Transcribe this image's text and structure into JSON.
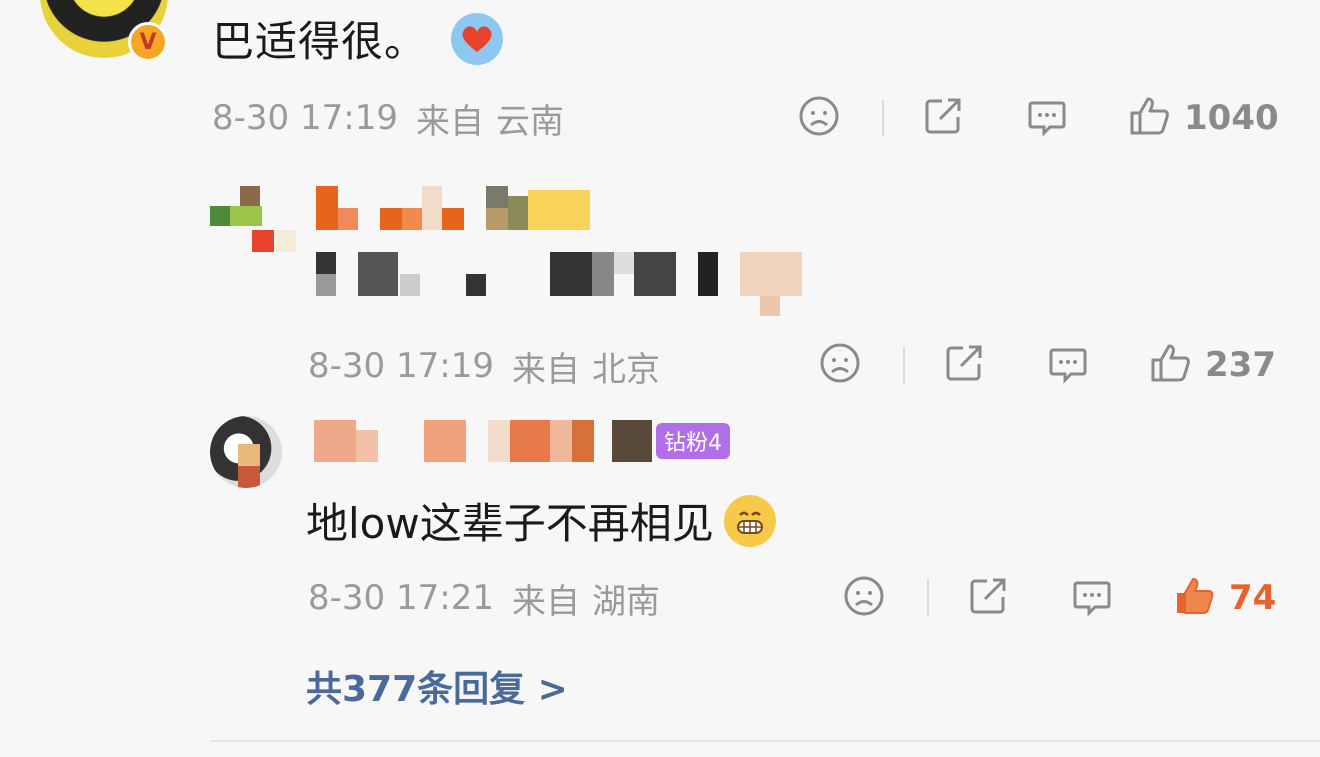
{
  "main_comment": {
    "text": "巴适得很。",
    "badge": "V",
    "time": "8-30 17:19",
    "from_label": "来自",
    "location": "云南",
    "likes": "1040"
  },
  "reply1": {
    "time": "8-30 17:19",
    "from_label": "来自",
    "location": "北京",
    "likes": "237"
  },
  "reply2": {
    "fan_badge": "钻粉4",
    "text": "地low这辈子不再相见",
    "time": "8-30 17:21",
    "from_label": "来自",
    "location": "湖南",
    "likes": "74"
  },
  "more_replies": "共377条回复 >",
  "colors": {
    "like_active": "#e8632c",
    "link": "#4a6a9a",
    "meta_gray": "#9a9a9a",
    "fan_badge": "#b06ee8"
  }
}
